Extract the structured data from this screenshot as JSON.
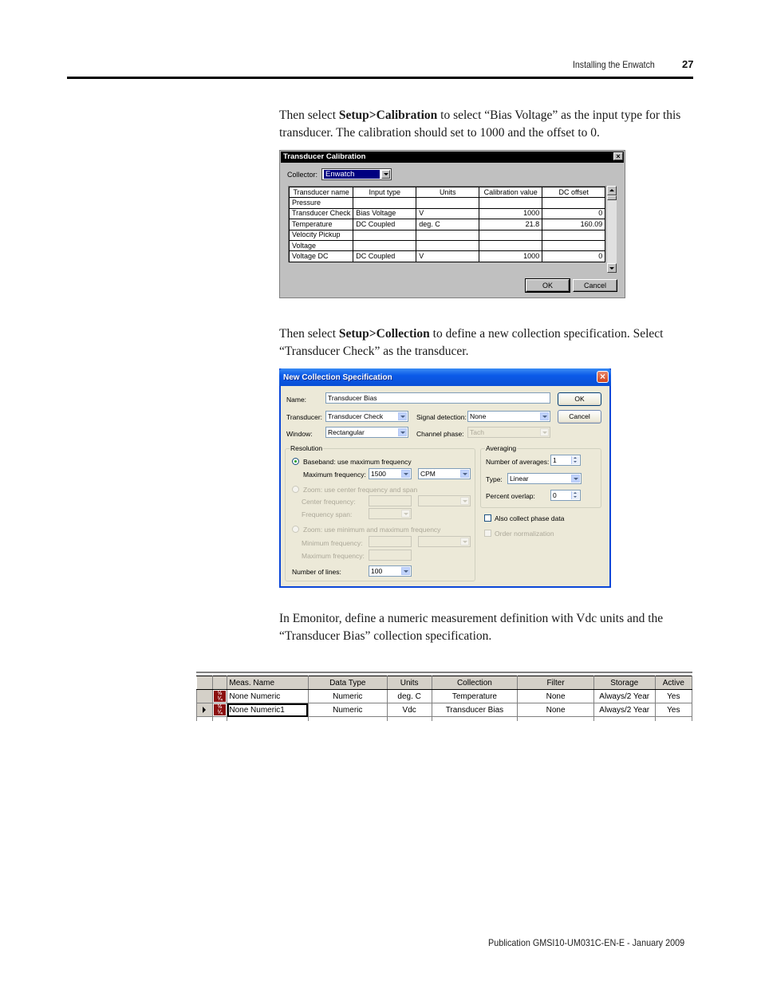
{
  "header": {
    "section_title": "Installing the Enwatch",
    "page_number": "27"
  },
  "paragraphs": [
    {
      "before": "Then select ",
      "bold": "Setup>Calibration",
      "after": " to select “Bias Voltage” as the input type for this transducer. The calibration should set to 1000 and the offset to 0."
    },
    {
      "before": "Then select ",
      "bold": "Setup>Collection",
      "after": " to define a new collection specification. Select “Transducer Check” as the transducer."
    },
    {
      "before": "In Emonitor, define a numeric measurement definition with Vdc units and the “Transducer Bias” collection specification.",
      "bold": "",
      "after": ""
    }
  ],
  "calibration_dialog": {
    "title": "Transducer Calibration",
    "close_icon": "close-icon",
    "collector_label": "Collector:",
    "collector_value": "Enwatch",
    "columns": [
      "Transducer name",
      "Input type",
      "Units",
      "Calibration value",
      "DC offset"
    ],
    "rows": [
      [
        "Pressure",
        "",
        "",
        "",
        ""
      ],
      [
        "Transducer Check",
        "Bias Voltage",
        "V",
        "1000",
        "0"
      ],
      [
        "Temperature",
        "DC Coupled",
        "deg. C",
        "21.8",
        "160.09"
      ],
      [
        "Velocity Pickup",
        "",
        "",
        "",
        ""
      ],
      [
        "Voltage",
        "",
        "",
        "",
        ""
      ],
      [
        "Voltage DC",
        "DC Coupled",
        "V",
        "1000",
        "0"
      ]
    ],
    "ok_label": "OK",
    "cancel_label": "Cancel"
  },
  "collection_dialog": {
    "title": "New Collection Specification",
    "name_label": "Name:",
    "name_value": "Transducer Bias",
    "transducer_label": "Transducer:",
    "transducer_value": "Transducer Check",
    "window_label": "Window:",
    "window_value": "Rectangular",
    "signal_detection_label": "Signal detection:",
    "signal_detection_value": "None",
    "channel_phase_label": "Channel phase:",
    "channel_phase_value": "Tach",
    "ok_label": "OK",
    "cancel_label": "Cancel",
    "resolution": {
      "group_label": "Resolution",
      "baseband_label": "Baseband: use maximum frequency",
      "baseband_selected": true,
      "max_freq_label": "Maximum frequency:",
      "max_freq_value": "1500",
      "max_freq_units": "CPM",
      "zoom_center_label": "Zoom: use center frequency and span",
      "center_freq_label": "Center frequency:",
      "freq_span_label": "Frequency span:",
      "zoom_minmax_label": "Zoom: use minimum and maximum frequency",
      "min_freq_label": "Minimum frequency:",
      "max_freq2_label": "Maximum frequency:",
      "lines_label": "Number of lines:",
      "lines_value": "100"
    },
    "averaging": {
      "group_label": "Averaging",
      "num_avg_label": "Number of averages:",
      "num_avg_value": "1",
      "type_label": "Type:",
      "type_value": "Linear",
      "overlap_label": "Percent overlap:",
      "overlap_value": "0"
    },
    "phase_data_label": "Also collect phase data",
    "phase_data_checked": false,
    "order_norm_label": "Order normalization",
    "order_norm_checked": false
  },
  "emonitor_grid": {
    "columns": [
      "Meas. Name",
      "Data Type",
      "Units",
      "Collection",
      "Filter",
      "Storage",
      "Active"
    ],
    "rows": [
      {
        "icon": "numeric-measurement-icon",
        "cells": [
          "None Numeric",
          "Numeric",
          "deg. C",
          "Temperature",
          "None",
          "Always/2 Year",
          "Yes"
        ],
        "current": false
      },
      {
        "icon": "numeric-measurement-icon",
        "cells": [
          "None Numeric1",
          "Numeric",
          "Vdc",
          "Transducer Bias",
          "None",
          "Always/2 Year",
          "Yes"
        ],
        "current": true
      }
    ]
  },
  "footer": {
    "publication": "Publication GMSI10-UM031C-EN-E - January 2009"
  }
}
